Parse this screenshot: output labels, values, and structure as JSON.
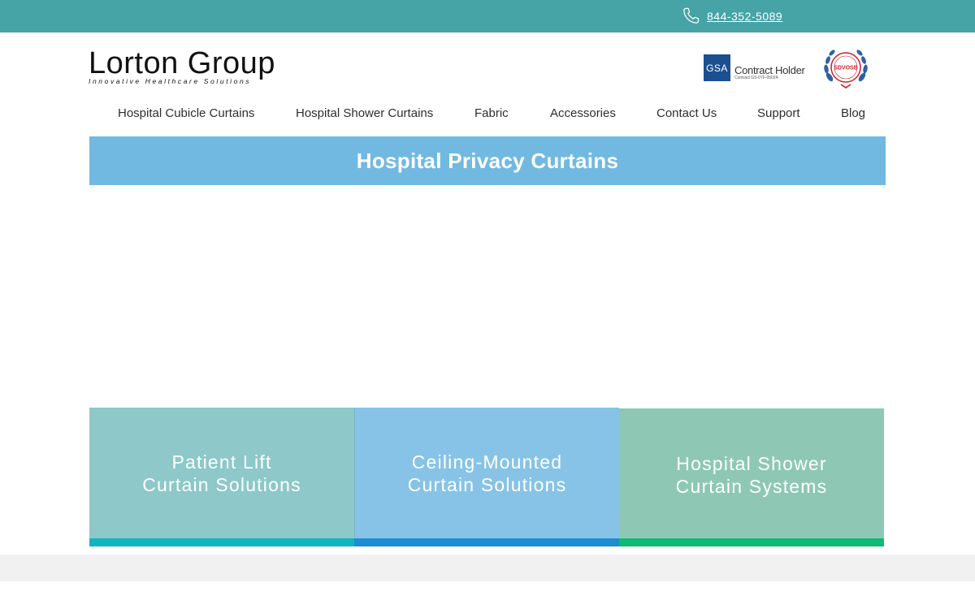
{
  "topbar": {
    "phone_icon": "phone-icon",
    "phone_number": "844-352-5089",
    "background": "#46a3a6"
  },
  "logo": {
    "title": "Lorton Group",
    "tagline": "Innovative Healthcare Solutions"
  },
  "badges": {
    "gsa_mark": "GSA",
    "gsa_title": "Contract Holder",
    "gsa_subtitle": "Contract GS-07F-0502A",
    "seal_label": "SDVOSB",
    "seal_icon": "laurel-seal-icon"
  },
  "nav": {
    "items": [
      {
        "label": "Hospital Cubicle Curtains"
      },
      {
        "label": "Hospital Shower Curtains"
      },
      {
        "label": "Fabric"
      },
      {
        "label": "Accessories"
      },
      {
        "label": "Contact Us"
      },
      {
        "label": "Support"
      },
      {
        "label": "Blog"
      }
    ]
  },
  "banner": {
    "title": "Hospital Privacy Curtains",
    "color": "#72b9e1"
  },
  "tiles": [
    {
      "line1": "Patient Lift",
      "line2": "Curtain Solutions",
      "bg": "#8ec8c8",
      "bar": "#11b5c0"
    },
    {
      "line1": "Ceiling-Mounted",
      "line2": "Curtain Solutions",
      "bg": "#87c3e6",
      "bar": "#1c8ed0"
    },
    {
      "line1": "Hospital Shower",
      "line2": "Curtain Systems",
      "bg": "#8ec8b5",
      "bar": "#0fba74"
    }
  ]
}
